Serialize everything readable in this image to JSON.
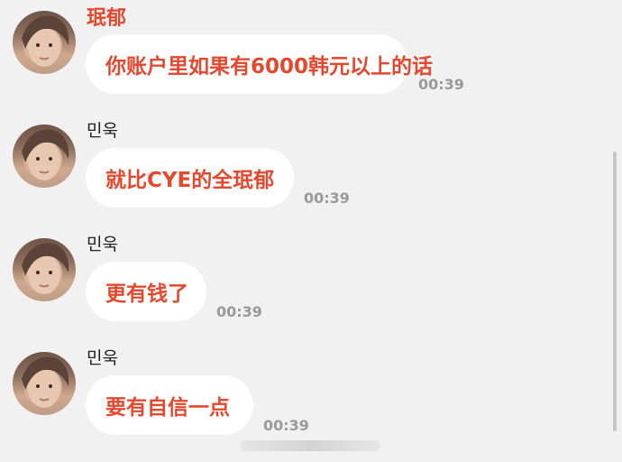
{
  "messages": [
    {
      "sender": "珉郁",
      "text": "你账户里如果有6000韩元以上的话",
      "time": "00:39"
    },
    {
      "sender": "민욱",
      "text": "就比CYE的全珉郁",
      "time": "00:39"
    },
    {
      "sender": "민욱",
      "text": "更有钱了",
      "time": "00:39"
    },
    {
      "sender": "민욱",
      "text": "要有自信一点",
      "time": "00:39"
    }
  ],
  "colors": {
    "accent_text": "#e2492f",
    "bubble": "#ffffff",
    "background": "#f1f1f1"
  }
}
